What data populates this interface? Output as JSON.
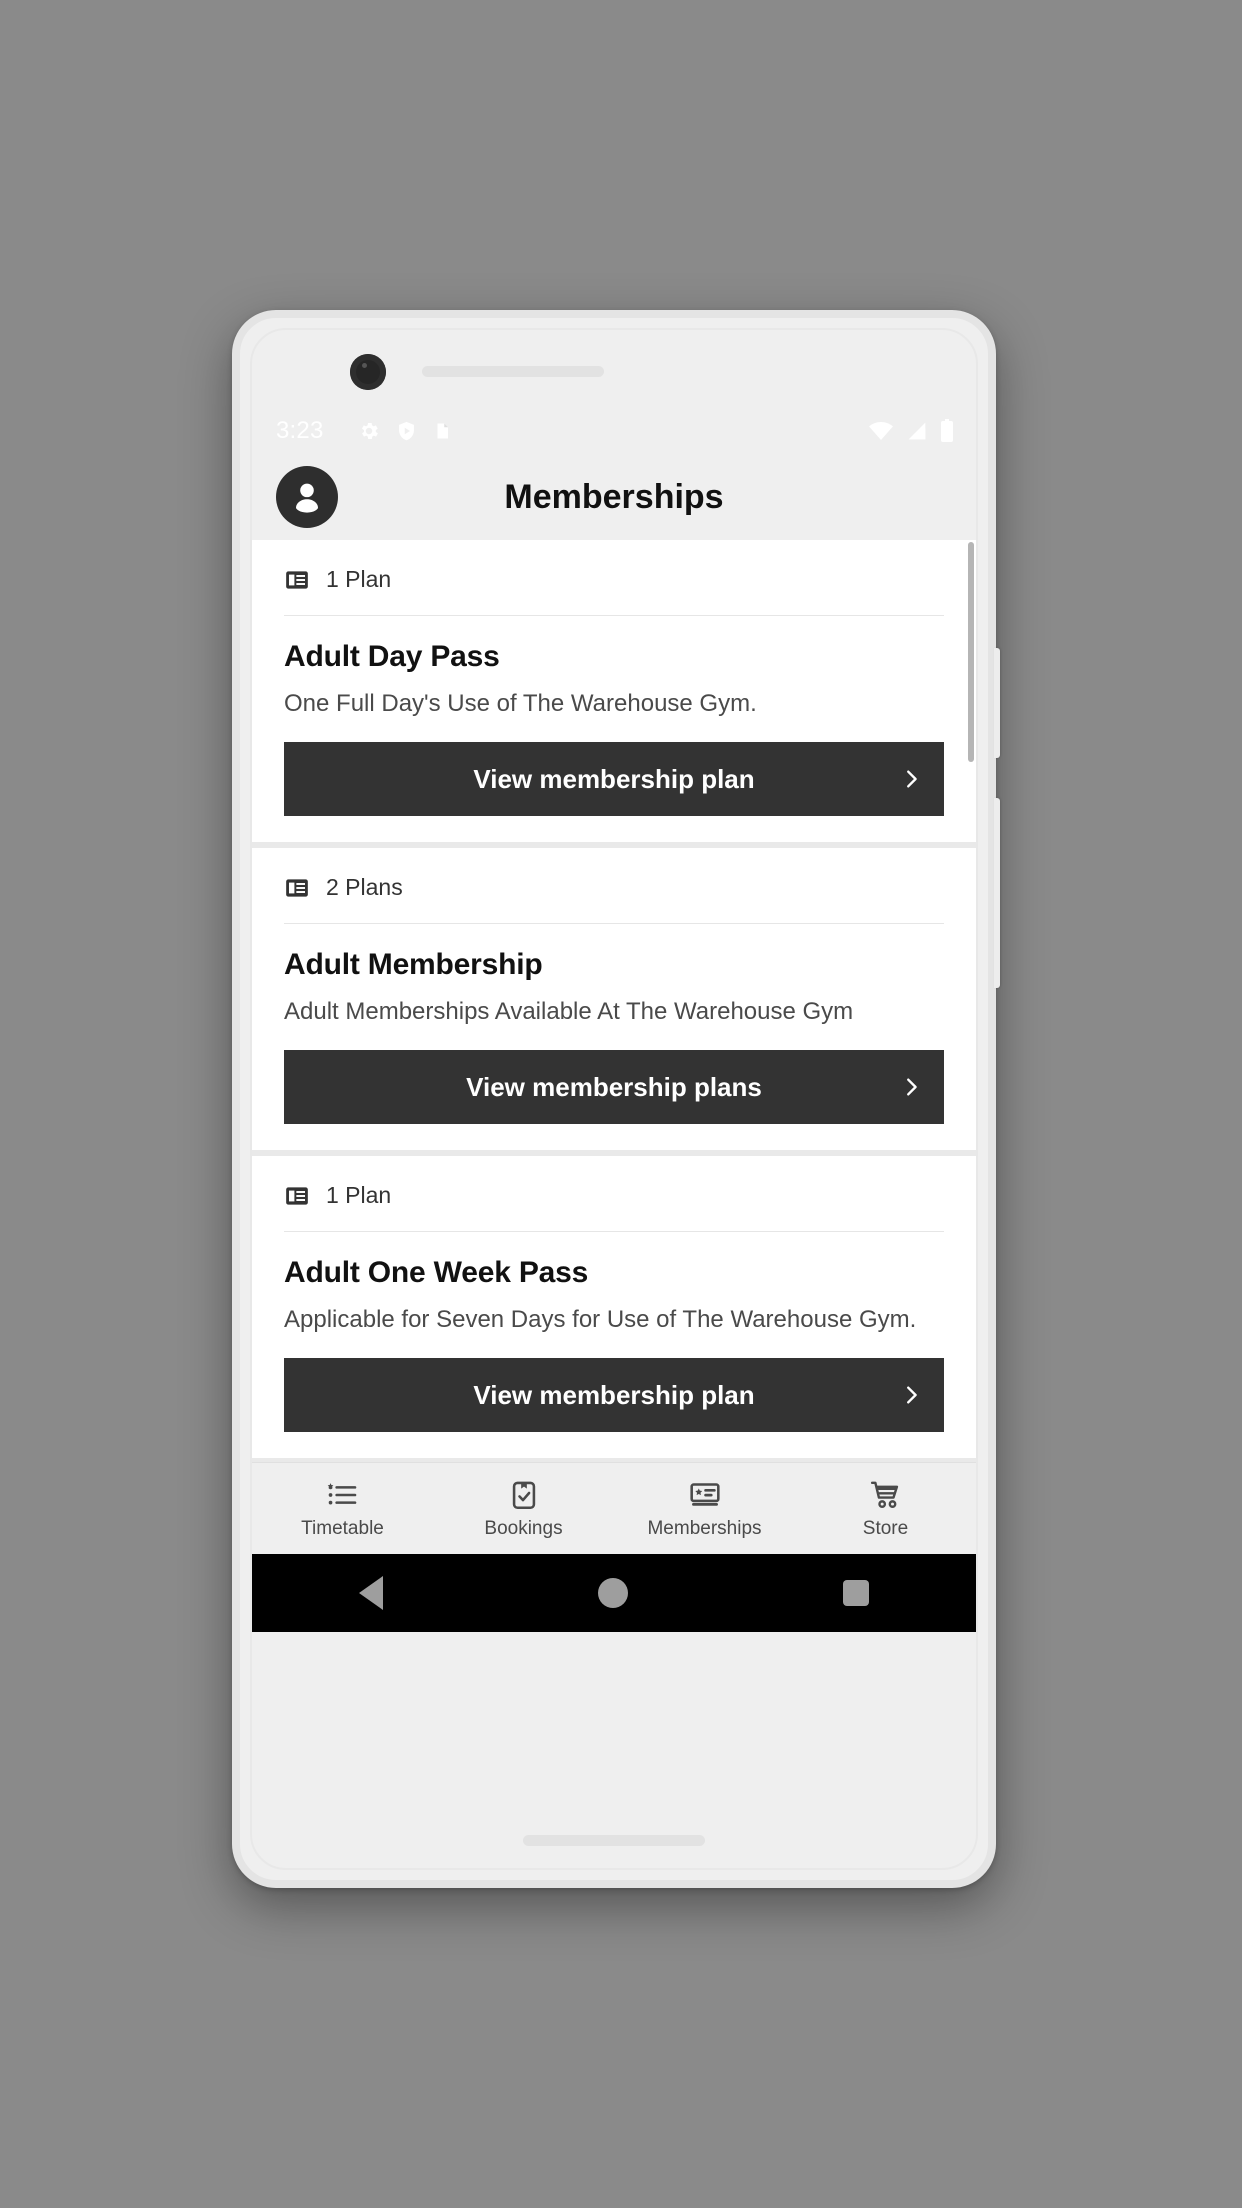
{
  "status_bar": {
    "time": "3:23",
    "left_icons": [
      "gear-icon",
      "shield-play-icon",
      "clipboard-icon"
    ],
    "right_icons": [
      "wifi-icon",
      "cell-signal-icon",
      "battery-icon"
    ]
  },
  "app_bar": {
    "title": "Memberships",
    "avatar_icon": "account-circle-icon"
  },
  "cards": [
    {
      "plan_count_label": "1 Plan",
      "plan_icon": "article-icon",
      "title": "Adult Day Pass",
      "description": "One Full Day's Use of The Warehouse Gym.",
      "cta_label": "View membership plan",
      "cta_icon": "chevron-right-icon"
    },
    {
      "plan_count_label": "2 Plans",
      "plan_icon": "article-icon",
      "title": "Adult Membership",
      "description": "Adult Memberships Available At The Warehouse Gym",
      "cta_label": "View membership plans",
      "cta_icon": "chevron-right-icon"
    },
    {
      "plan_count_label": "1 Plan",
      "plan_icon": "article-icon",
      "title": "Adult One Week Pass",
      "description": "Applicable for Seven Days for Use of The Warehouse Gym.",
      "cta_label": "View membership plan",
      "cta_icon": "chevron-right-icon"
    }
  ],
  "bottom_nav": {
    "items": [
      {
        "label": "Timetable",
        "icon": "list-star-icon"
      },
      {
        "label": "Bookings",
        "icon": "clipboard-check-icon"
      },
      {
        "label": "Memberships",
        "icon": "membership-card-icon"
      },
      {
        "label": "Store",
        "icon": "shopping-cart-icon"
      }
    ]
  },
  "system_nav": {
    "back": "back-triangle-icon",
    "home": "home-circle-icon",
    "recents": "recents-square-icon"
  },
  "colors": {
    "accent_dark": "#333333",
    "screen_bg": "#efefef",
    "card_bg": "#ffffff",
    "body_bg": "#8a8a8a"
  }
}
